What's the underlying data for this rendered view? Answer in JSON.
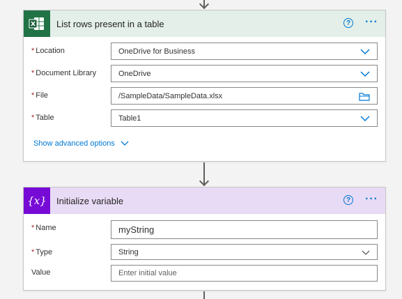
{
  "colors": {
    "excel_header_bg": "#e3efe8",
    "excel_icon_bg": "#217346",
    "variable_header_bg": "#e8dbf5",
    "variable_icon_bg": "#770bd6",
    "link": "#0078d4",
    "required": "#a4262c"
  },
  "list_rows_action": {
    "icon": "excel-icon",
    "title": "List rows present in a table",
    "help_icon": "question-circle-icon",
    "more_icon": "ellipsis-icon",
    "fields": {
      "location": {
        "label": "Location",
        "required": true,
        "value": "OneDrive for Business",
        "control": "dropdown"
      },
      "document_library": {
        "label": "Document Library",
        "required": true,
        "value": "OneDrive",
        "control": "dropdown"
      },
      "file": {
        "label": "File",
        "required": true,
        "value": "/SampleData/SampleData.xlsx",
        "control": "file-picker"
      },
      "table": {
        "label": "Table",
        "required": true,
        "value": "Table1",
        "control": "dropdown"
      }
    },
    "advanced_options_label": "Show advanced options"
  },
  "init_variable_action": {
    "icon": "variable-icon",
    "icon_glyph": "{x}",
    "title": "Initialize variable",
    "help_icon": "question-circle-icon",
    "more_icon": "ellipsis-icon",
    "fields": {
      "name": {
        "label": "Name",
        "required": true,
        "value": "myString",
        "control": "text"
      },
      "type": {
        "label": "Type",
        "required": true,
        "value": "String",
        "control": "dropdown"
      },
      "value": {
        "label": "Value",
        "required": false,
        "placeholder": "Enter initial value",
        "control": "text"
      }
    }
  }
}
